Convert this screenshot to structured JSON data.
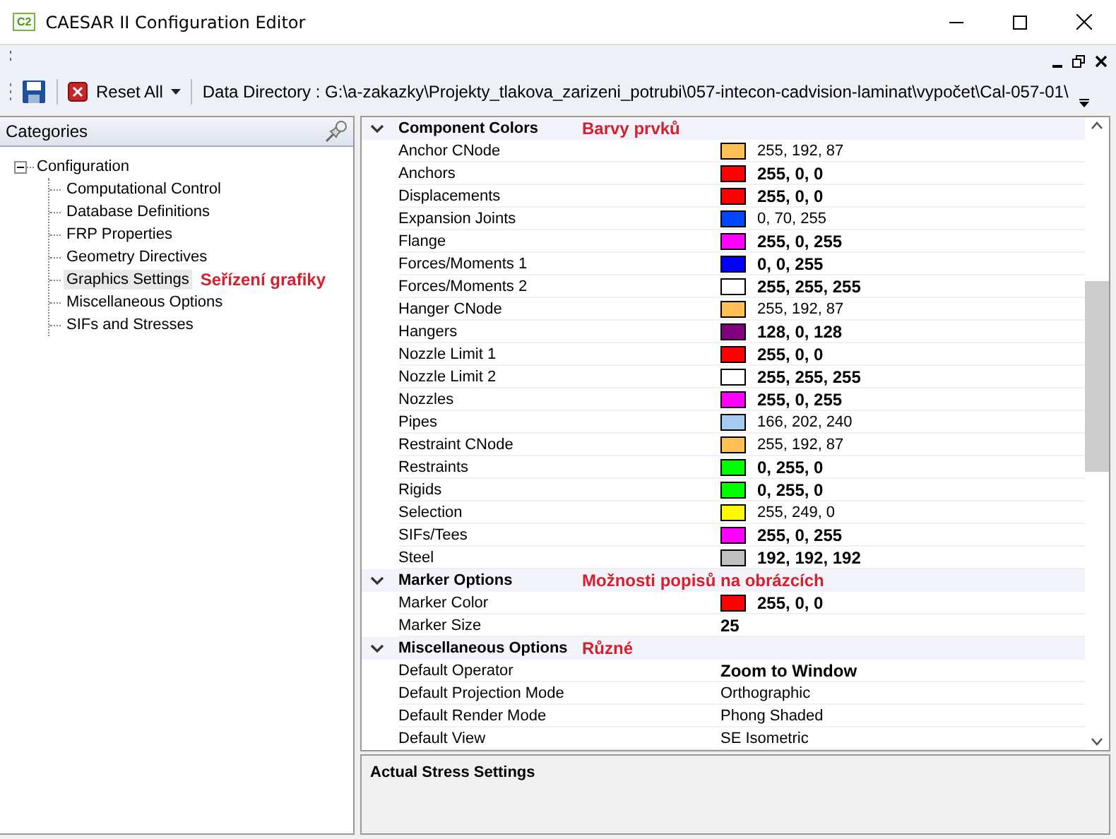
{
  "window": {
    "title": "CAESAR II Configuration Editor",
    "icon_label": "C2"
  },
  "toolbar": {
    "reset_label": "Reset All",
    "data_directory": "Data Directory : G:\\a-zakazky\\Projekty_tlakova_zarizeni_potrubi\\057-intecon-cadvision-laminat\\vypočet\\Cal-057-01\\"
  },
  "categories": {
    "title": "Categories",
    "root": {
      "label": "Configuration",
      "expanded": true,
      "children": [
        {
          "label": "Computational Control",
          "selected": false
        },
        {
          "label": "Database Definitions",
          "selected": false
        },
        {
          "label": "FRP Properties",
          "selected": false
        },
        {
          "label": "Geometry Directives",
          "selected": false
        },
        {
          "label": "Graphics Settings",
          "selected": true,
          "annotation": "Seřízení grafiky"
        },
        {
          "label": "Miscellaneous Options",
          "selected": false
        },
        {
          "label": "SIFs and Stresses",
          "selected": false
        }
      ]
    }
  },
  "groups": [
    {
      "title": "Component Colors",
      "expanded": true,
      "annotation": "Barvy prvků",
      "rows": [
        {
          "name": "Anchor CNode",
          "kind": "color",
          "color": "#ffc057",
          "value": "255, 192, 87",
          "modified": false
        },
        {
          "name": "Anchors",
          "kind": "color",
          "color": "#ff0000",
          "value": "255, 0, 0",
          "modified": true
        },
        {
          "name": "Displacements",
          "kind": "color",
          "color": "#ff0000",
          "value": "255, 0, 0",
          "modified": true
        },
        {
          "name": "Expansion Joints",
          "kind": "color",
          "color": "#0046ff",
          "value": "0, 70, 255",
          "modified": false
        },
        {
          "name": "Flange",
          "kind": "color",
          "color": "#ff00ff",
          "value": "255, 0, 255",
          "modified": true
        },
        {
          "name": "Forces/Moments 1",
          "kind": "color",
          "color": "#0000ff",
          "value": "0, 0, 255",
          "modified": true
        },
        {
          "name": "Forces/Moments 2",
          "kind": "color",
          "color": "#ffffff",
          "value": "255, 255, 255",
          "modified": true
        },
        {
          "name": "Hanger CNode",
          "kind": "color",
          "color": "#ffc057",
          "value": "255, 192, 87",
          "modified": false
        },
        {
          "name": "Hangers",
          "kind": "color",
          "color": "#800080",
          "value": "128, 0, 128",
          "modified": true
        },
        {
          "name": "Nozzle Limit 1",
          "kind": "color",
          "color": "#ff0000",
          "value": "255, 0, 0",
          "modified": true
        },
        {
          "name": "Nozzle Limit 2",
          "kind": "color",
          "color": "#ffffff",
          "value": "255, 255, 255",
          "modified": true
        },
        {
          "name": "Nozzles",
          "kind": "color",
          "color": "#ff00ff",
          "value": "255, 0, 255",
          "modified": true
        },
        {
          "name": "Pipes",
          "kind": "color",
          "color": "#a6caf0",
          "value": "166, 202, 240",
          "modified": false
        },
        {
          "name": "Restraint CNode",
          "kind": "color",
          "color": "#ffc057",
          "value": "255, 192, 87",
          "modified": false
        },
        {
          "name": "Restraints",
          "kind": "color",
          "color": "#00ff00",
          "value": "0, 255, 0",
          "modified": true
        },
        {
          "name": "Rigids",
          "kind": "color",
          "color": "#00ff00",
          "value": "0, 255, 0",
          "modified": true
        },
        {
          "name": "Selection",
          "kind": "color",
          "color": "#fff900",
          "value": "255, 249, 0",
          "modified": false
        },
        {
          "name": "SIFs/Tees",
          "kind": "color",
          "color": "#ff00ff",
          "value": "255, 0, 255",
          "modified": true
        },
        {
          "name": "Steel",
          "kind": "color",
          "color": "#c0c0c0",
          "value": "192, 192, 192",
          "modified": true
        }
      ]
    },
    {
      "title": "Marker Options",
      "expanded": true,
      "annotation": "Možnosti popisů na obrázcích",
      "rows": [
        {
          "name": "Marker Color",
          "kind": "color",
          "color": "#ff0000",
          "value": "255, 0, 0",
          "modified": true
        },
        {
          "name": "Marker Size",
          "kind": "text",
          "value": "25",
          "modified": true
        }
      ]
    },
    {
      "title": "Miscellaneous Options",
      "expanded": true,
      "annotation": "Různé",
      "rows": [
        {
          "name": "Default Operator",
          "kind": "text",
          "value": "Zoom to Window",
          "modified": true
        },
        {
          "name": "Default Projection Mode",
          "kind": "text",
          "value": "Orthographic",
          "modified": false
        },
        {
          "name": "Default Render Mode",
          "kind": "text",
          "value": "Phong Shaded",
          "modified": false
        },
        {
          "name": "Default View",
          "kind": "text",
          "value": "SE Isometric",
          "modified": false
        }
      ]
    }
  ],
  "description": {
    "title": "Actual Stress Settings"
  }
}
